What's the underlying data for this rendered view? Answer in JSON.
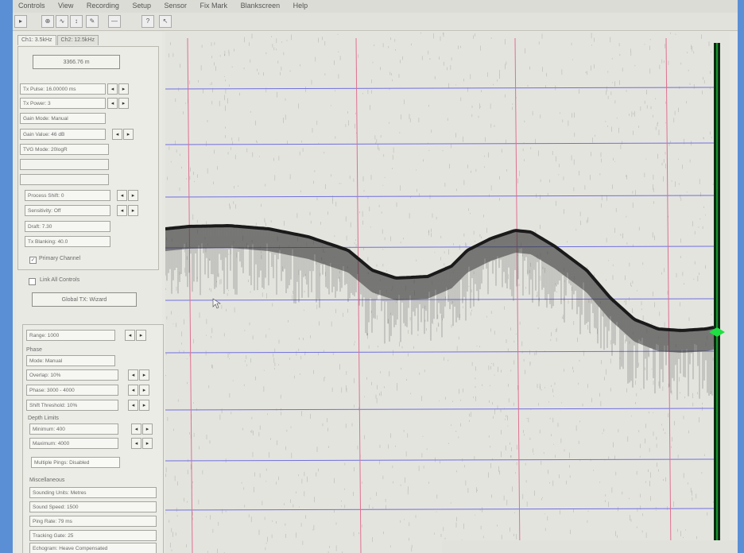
{
  "menu": [
    "Controls",
    "View",
    "Recording",
    "Setup",
    "Sensor",
    "Fix Mark",
    "Blankscreen",
    "Help"
  ],
  "toolbar_icons": [
    "cursor-icon",
    "zoom-icon",
    "tide-icon",
    "scale-icon",
    "edit-icon",
    "line-icon",
    "help-icon",
    "context-help-icon"
  ],
  "tabs": [
    "Ch1: 3.5kHz",
    "Ch2: 12.5kHz"
  ],
  "depth_readout": "3366.76 m",
  "channel_fields": {
    "tx_pulse": "Tx Pulse: 16.00000 ms",
    "tx_power": "Tx Power: 3",
    "gain_mode": "Gain Mode: Manual",
    "gain_value": "Gain Value: 46 dB",
    "tvg_mode": "TVG Mode: 20logR",
    "process_shift": "Process Shift: 0",
    "sensitivity": "Sensitivity: Off",
    "draft": "Draft: 7.30",
    "tx_blanking": "Tx Blanking: 40.0"
  },
  "primary_channel": "Primary Channel",
  "link_all_controls": "Link All Controls",
  "global_tx_wizard": "Global TX: Wizard",
  "range_fields": {
    "range": "Range: 1000",
    "phase_label": "Phase",
    "mode": "Mode: Manual",
    "overlap": "Overlap: 10%",
    "phase": "Phase: 3000 - 4000",
    "shift_threshold": "Shift Threshold: 10%"
  },
  "depth_limits": {
    "label": "Depth Limits",
    "minimum": "Minimum: 400",
    "maximum": "Maximum: 4000"
  },
  "multiple_pings": "Multiple Pings: Disabled",
  "misc": {
    "label": "Miscellaneous",
    "sounding_units": "Sounding Units: Metres",
    "sound_speed": "Sound Speed: 1500",
    "ping_rate": "Ping Rate: 79 ms",
    "tracking_gate": "Tracking Gate: 25",
    "echogram": "Echogram: Heave Compensated"
  },
  "colors": {
    "grid_horizontal": "#6f6fe0",
    "grid_vertical": "#e07090",
    "echo": "#1a1a1a",
    "cursor_bar": "#1fe042"
  }
}
